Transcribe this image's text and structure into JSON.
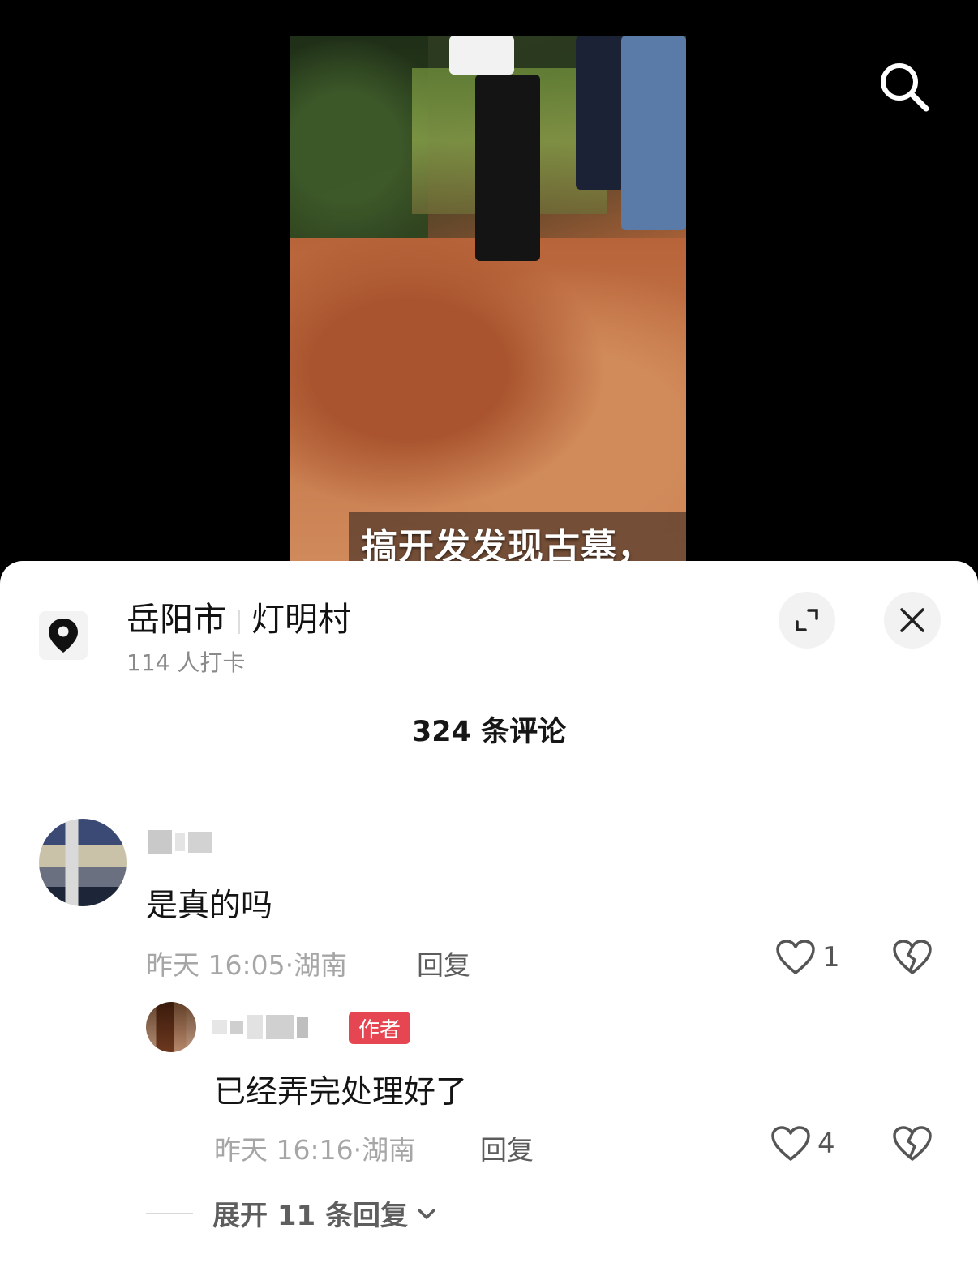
{
  "video": {
    "caption": "搞开发发现古墓，"
  },
  "location": {
    "city": "岳阳市",
    "village": "灯明村",
    "checkins": "114 人打卡"
  },
  "comments_header": {
    "title": "324 条评论"
  },
  "comments": [
    {
      "text": "是真的吗",
      "time": "昨天 16:05",
      "region": "湖南",
      "reply_label": "回复",
      "likes": "1"
    }
  ],
  "reply": {
    "badge": "作者",
    "text": "已经弄完处理好了",
    "time": "昨天 16:16",
    "region": "湖南",
    "reply_label": "回复",
    "likes": "4"
  },
  "expand_replies": {
    "label": "展开 11 条回复"
  },
  "icons": {
    "search": "search-icon",
    "location": "location-pin-icon",
    "expand": "expand-icon",
    "close": "close-icon",
    "like": "heart-icon",
    "dislike": "broken-heart-icon",
    "chevron": "chevron-down-icon"
  },
  "colors": {
    "author_badge": "#e64552",
    "sheet_bg": "#ffffff"
  }
}
